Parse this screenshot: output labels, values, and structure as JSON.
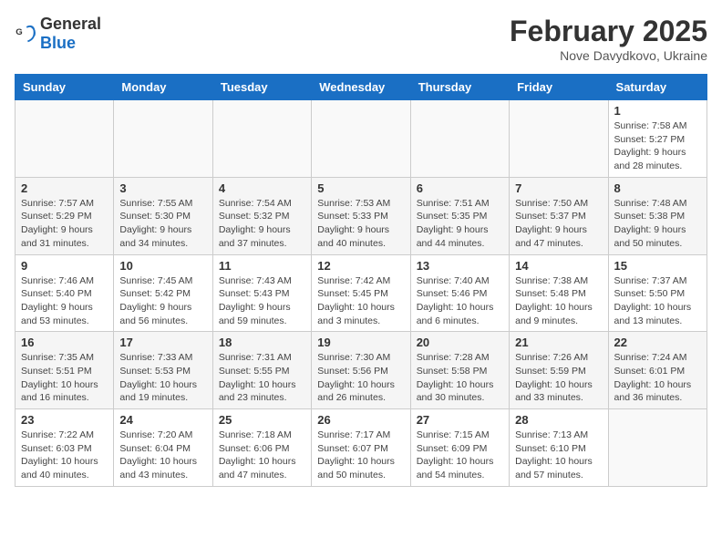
{
  "logo": {
    "general": "General",
    "blue": "Blue"
  },
  "title": "February 2025",
  "subtitle": "Nove Davydkovo, Ukraine",
  "days_header": [
    "Sunday",
    "Monday",
    "Tuesday",
    "Wednesday",
    "Thursday",
    "Friday",
    "Saturday"
  ],
  "weeks": [
    [
      {
        "day": "",
        "info": ""
      },
      {
        "day": "",
        "info": ""
      },
      {
        "day": "",
        "info": ""
      },
      {
        "day": "",
        "info": ""
      },
      {
        "day": "",
        "info": ""
      },
      {
        "day": "",
        "info": ""
      },
      {
        "day": "1",
        "info": "Sunrise: 7:58 AM\nSunset: 5:27 PM\nDaylight: 9 hours and 28 minutes."
      }
    ],
    [
      {
        "day": "2",
        "info": "Sunrise: 7:57 AM\nSunset: 5:29 PM\nDaylight: 9 hours and 31 minutes."
      },
      {
        "day": "3",
        "info": "Sunrise: 7:55 AM\nSunset: 5:30 PM\nDaylight: 9 hours and 34 minutes."
      },
      {
        "day": "4",
        "info": "Sunrise: 7:54 AM\nSunset: 5:32 PM\nDaylight: 9 hours and 37 minutes."
      },
      {
        "day": "5",
        "info": "Sunrise: 7:53 AM\nSunset: 5:33 PM\nDaylight: 9 hours and 40 minutes."
      },
      {
        "day": "6",
        "info": "Sunrise: 7:51 AM\nSunset: 5:35 PM\nDaylight: 9 hours and 44 minutes."
      },
      {
        "day": "7",
        "info": "Sunrise: 7:50 AM\nSunset: 5:37 PM\nDaylight: 9 hours and 47 minutes."
      },
      {
        "day": "8",
        "info": "Sunrise: 7:48 AM\nSunset: 5:38 PM\nDaylight: 9 hours and 50 minutes."
      }
    ],
    [
      {
        "day": "9",
        "info": "Sunrise: 7:46 AM\nSunset: 5:40 PM\nDaylight: 9 hours and 53 minutes."
      },
      {
        "day": "10",
        "info": "Sunrise: 7:45 AM\nSunset: 5:42 PM\nDaylight: 9 hours and 56 minutes."
      },
      {
        "day": "11",
        "info": "Sunrise: 7:43 AM\nSunset: 5:43 PM\nDaylight: 9 hours and 59 minutes."
      },
      {
        "day": "12",
        "info": "Sunrise: 7:42 AM\nSunset: 5:45 PM\nDaylight: 10 hours and 3 minutes."
      },
      {
        "day": "13",
        "info": "Sunrise: 7:40 AM\nSunset: 5:46 PM\nDaylight: 10 hours and 6 minutes."
      },
      {
        "day": "14",
        "info": "Sunrise: 7:38 AM\nSunset: 5:48 PM\nDaylight: 10 hours and 9 minutes."
      },
      {
        "day": "15",
        "info": "Sunrise: 7:37 AM\nSunset: 5:50 PM\nDaylight: 10 hours and 13 minutes."
      }
    ],
    [
      {
        "day": "16",
        "info": "Sunrise: 7:35 AM\nSunset: 5:51 PM\nDaylight: 10 hours and 16 minutes."
      },
      {
        "day": "17",
        "info": "Sunrise: 7:33 AM\nSunset: 5:53 PM\nDaylight: 10 hours and 19 minutes."
      },
      {
        "day": "18",
        "info": "Sunrise: 7:31 AM\nSunset: 5:55 PM\nDaylight: 10 hours and 23 minutes."
      },
      {
        "day": "19",
        "info": "Sunrise: 7:30 AM\nSunset: 5:56 PM\nDaylight: 10 hours and 26 minutes."
      },
      {
        "day": "20",
        "info": "Sunrise: 7:28 AM\nSunset: 5:58 PM\nDaylight: 10 hours and 30 minutes."
      },
      {
        "day": "21",
        "info": "Sunrise: 7:26 AM\nSunset: 5:59 PM\nDaylight: 10 hours and 33 minutes."
      },
      {
        "day": "22",
        "info": "Sunrise: 7:24 AM\nSunset: 6:01 PM\nDaylight: 10 hours and 36 minutes."
      }
    ],
    [
      {
        "day": "23",
        "info": "Sunrise: 7:22 AM\nSunset: 6:03 PM\nDaylight: 10 hours and 40 minutes."
      },
      {
        "day": "24",
        "info": "Sunrise: 7:20 AM\nSunset: 6:04 PM\nDaylight: 10 hours and 43 minutes."
      },
      {
        "day": "25",
        "info": "Sunrise: 7:18 AM\nSunset: 6:06 PM\nDaylight: 10 hours and 47 minutes."
      },
      {
        "day": "26",
        "info": "Sunrise: 7:17 AM\nSunset: 6:07 PM\nDaylight: 10 hours and 50 minutes."
      },
      {
        "day": "27",
        "info": "Sunrise: 7:15 AM\nSunset: 6:09 PM\nDaylight: 10 hours and 54 minutes."
      },
      {
        "day": "28",
        "info": "Sunrise: 7:13 AM\nSunset: 6:10 PM\nDaylight: 10 hours and 57 minutes."
      },
      {
        "day": "",
        "info": ""
      }
    ]
  ]
}
